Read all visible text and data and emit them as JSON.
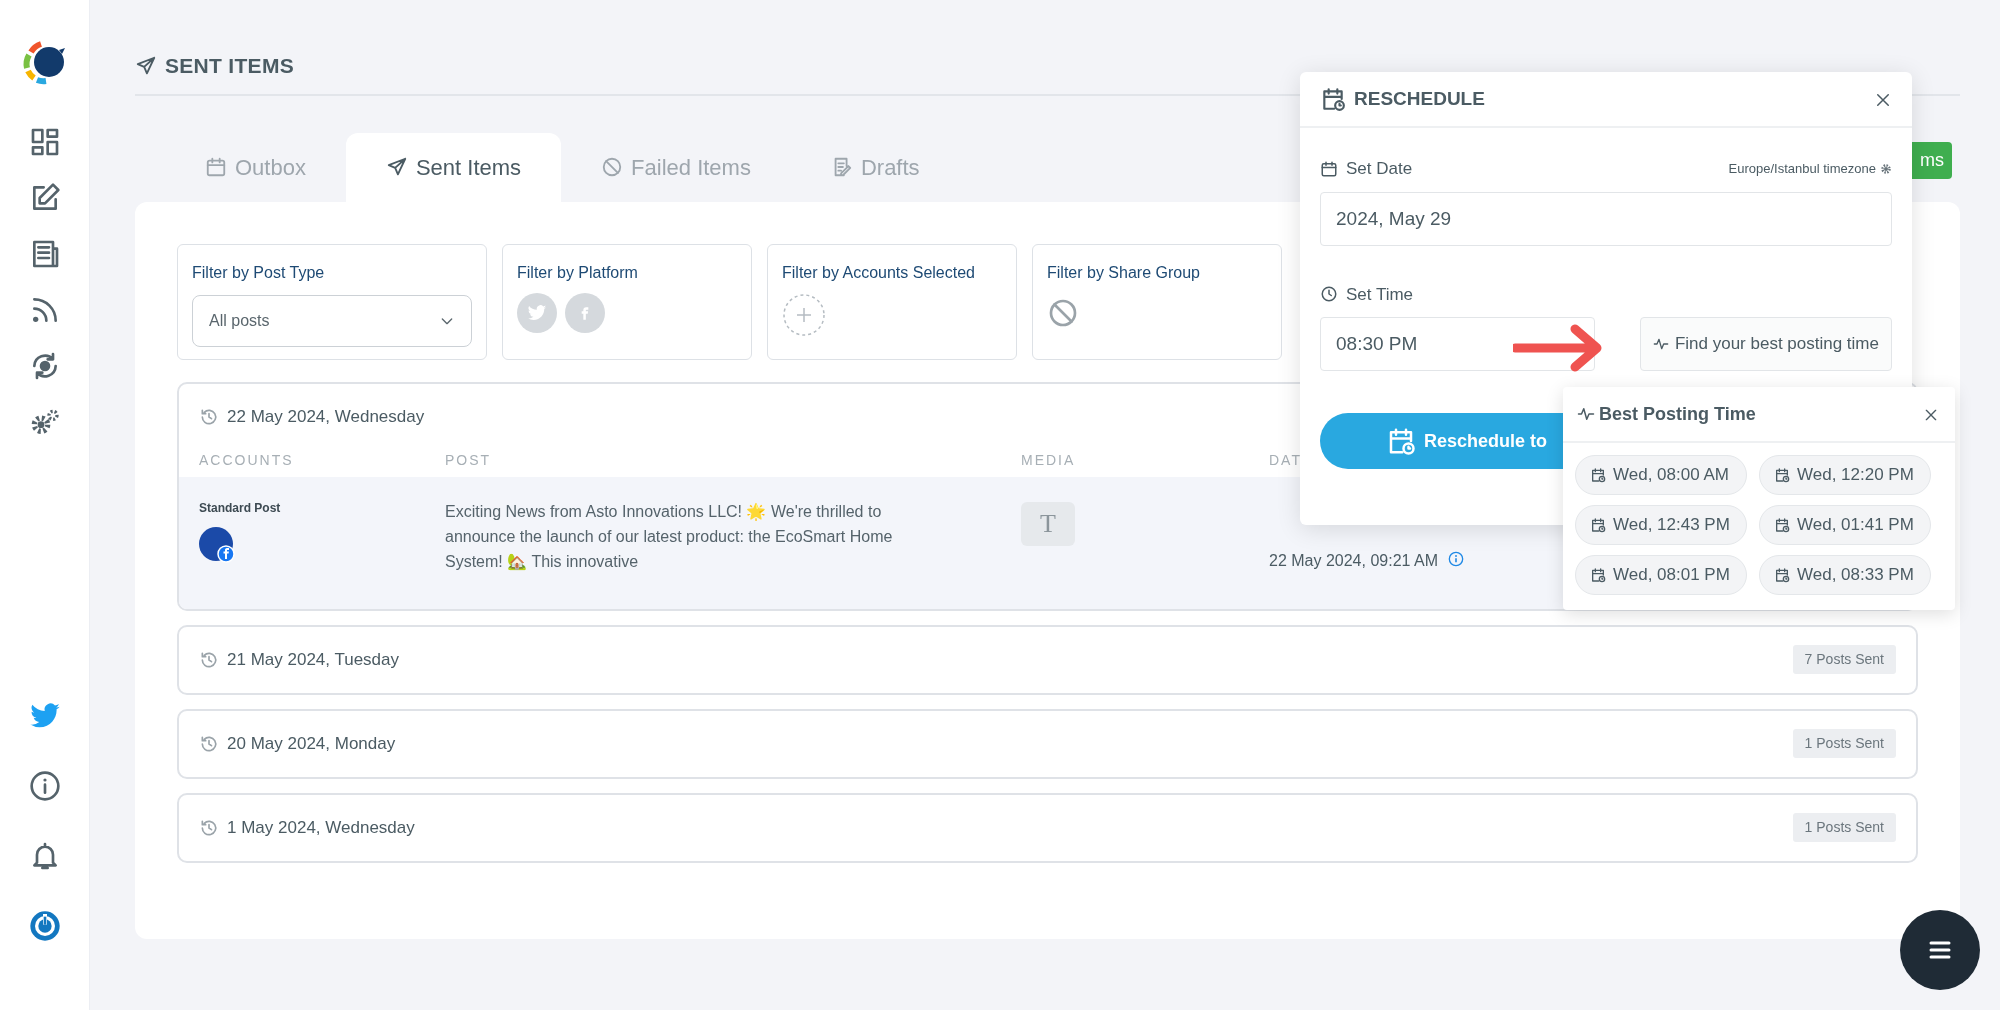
{
  "page_title": "SENT ITEMS",
  "tabs": [
    {
      "label": "Outbox",
      "selected": false
    },
    {
      "label": "Sent Items",
      "selected": true
    },
    {
      "label": "Failed Items",
      "selected": false
    },
    {
      "label": "Drafts",
      "selected": false
    }
  ],
  "header_button": "ms",
  "filters": [
    {
      "kind": "select",
      "label": "Filter by Post Type",
      "value": "All posts"
    },
    {
      "kind": "platforms",
      "label": "Filter by Platform"
    },
    {
      "kind": "accounts",
      "label": "Filter by Accounts Selected"
    },
    {
      "kind": "share_group",
      "label": "Filter by Share Group"
    }
  ],
  "groups": [
    {
      "date": "22 May 2024, Wednesday",
      "expanded": true,
      "columns": [
        "ACCOUNTS",
        "POST",
        "MEDIA",
        "DAT"
      ],
      "posts": [
        {
          "type": "Standard Post",
          "text": "Exciting News from Asto Innovations LLC! 🌟 We're thrilled to announce the launch of our latest product: the EcoSmart Home System! 🏡 This innovative",
          "media": "T",
          "date": "22 May 2024, 09:21 AM"
        }
      ]
    },
    {
      "date": "21 May 2024, Tuesday",
      "expanded": false,
      "count": "7 Posts Sent"
    },
    {
      "date": "20 May 2024, Monday",
      "expanded": false,
      "count": "1 Posts Sent"
    },
    {
      "date": "1 May 2024, Wednesday",
      "expanded": false,
      "count": "1 Posts Sent"
    }
  ],
  "reschedule": {
    "title": "RESCHEDULE",
    "date_label": "Set Date",
    "timezone": "Europe/Istanbul timezone",
    "date_value": "2024, May 29",
    "time_label": "Set Time",
    "time_value": "08:30 PM",
    "best_time_button": "Find your best posting time",
    "submit": "Reschedule to"
  },
  "best_posting_time": {
    "title": "Best Posting Time",
    "slots": [
      "Wed, 08:00 AM",
      "Wed, 12:20 PM",
      "Wed, 12:43 PM",
      "Wed, 01:41 PM",
      "Wed, 08:01 PM",
      "Wed, 08:33 PM"
    ]
  }
}
